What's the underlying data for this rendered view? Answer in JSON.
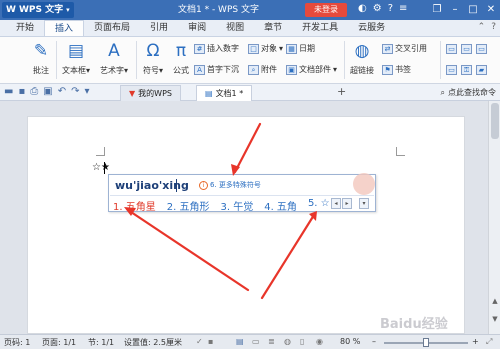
{
  "titlebar": {
    "app_name": "WPS 文字",
    "doc_title": "文档1 * - WPS 文字",
    "login": "未登录"
  },
  "ribbon_tabs": [
    "开始",
    "插入",
    "页面布局",
    "引用",
    "审阅",
    "视图",
    "章节",
    "开发工具",
    "云服务"
  ],
  "ribbon": {
    "pizhu": "批注",
    "textbox": "文本框",
    "art": "艺术字",
    "symbol": "符号",
    "formula": "公式",
    "insert_number": "插入数字",
    "object": "对象",
    "date": "日期",
    "first_drop": "首字下沉",
    "attachment": "附件",
    "doc_parts": "文档部件",
    "hyperlink": "超链接",
    "bookmark": "书签",
    "cross_ref": "交叉引用"
  },
  "doc_tabs": [
    "我的WPS",
    "文档1 *"
  ],
  "search_cmd": "点此查找命令",
  "document": {
    "text": "☆★"
  },
  "ime": {
    "pinyin": "wu'jiao'xing",
    "hint": "6. 更多特殊符号",
    "candidates": [
      "1. 五角星",
      "2. 五角形",
      "3. 午觉",
      "4. 五角",
      "5. ☆"
    ]
  },
  "statusbar": {
    "page_no": "页码: 1",
    "pages": "页面: 1/1",
    "section": "节: 1/1",
    "setting": "设置值: 2.5厘米",
    "zoom": "80 %"
  },
  "watermark": "Baidu经验",
  "colors": {
    "title_blue": "#3b6fb6",
    "login_red": "#e64a3c",
    "arrow_red": "#e8352a",
    "candidate_blue": "#2c6fc1"
  }
}
